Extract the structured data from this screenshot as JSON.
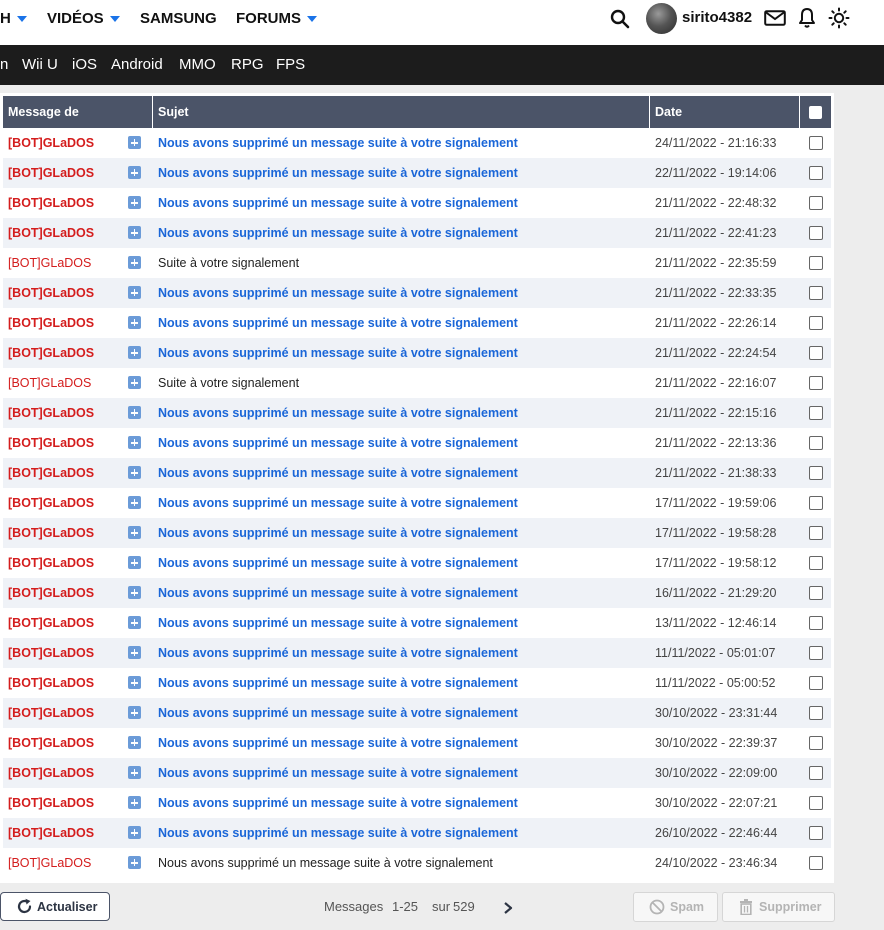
{
  "header": {
    "nav": [
      {
        "label": "H",
        "dropdown": true
      },
      {
        "label": "VIDÉOS",
        "dropdown": true
      },
      {
        "label": "SAMSUNG",
        "dropdown": false
      },
      {
        "label": "FORUMS",
        "dropdown": true
      }
    ],
    "user": {
      "name": "sirito4382"
    },
    "icons": [
      "search-icon",
      "avatar",
      "mail-icon",
      "bell-icon",
      "theme-sun-icon"
    ]
  },
  "categories": [
    "n",
    "Wii U",
    "iOS",
    "Android",
    "MMO",
    "RPG",
    "FPS"
  ],
  "table": {
    "columns": {
      "author": "Message de",
      "subject": "Sujet",
      "date": "Date"
    },
    "rows": [
      {
        "author": "[BOT]GLaDOS",
        "subject": "Nous avons supprimé un message suite à votre signalement",
        "date": "24/11/2022 - 21:16:33",
        "unread": true
      },
      {
        "author": "[BOT]GLaDOS",
        "subject": "Nous avons supprimé un message suite à votre signalement",
        "date": "22/11/2022 - 19:14:06",
        "unread": true
      },
      {
        "author": "[BOT]GLaDOS",
        "subject": "Nous avons supprimé un message suite à votre signalement",
        "date": "21/11/2022 - 22:48:32",
        "unread": true
      },
      {
        "author": "[BOT]GLaDOS",
        "subject": "Nous avons supprimé un message suite à votre signalement",
        "date": "21/11/2022 - 22:41:23",
        "unread": true
      },
      {
        "author": "[BOT]GLaDOS",
        "subject": "Suite à votre signalement",
        "date": "21/11/2022 - 22:35:59",
        "unread": false
      },
      {
        "author": "[BOT]GLaDOS",
        "subject": "Nous avons supprimé un message suite à votre signalement",
        "date": "21/11/2022 - 22:33:35",
        "unread": true
      },
      {
        "author": "[BOT]GLaDOS",
        "subject": "Nous avons supprimé un message suite à votre signalement",
        "date": "21/11/2022 - 22:26:14",
        "unread": true
      },
      {
        "author": "[BOT]GLaDOS",
        "subject": "Nous avons supprimé un message suite à votre signalement",
        "date": "21/11/2022 - 22:24:54",
        "unread": true
      },
      {
        "author": "[BOT]GLaDOS",
        "subject": "Suite à votre signalement",
        "date": "21/11/2022 - 22:16:07",
        "unread": false
      },
      {
        "author": "[BOT]GLaDOS",
        "subject": "Nous avons supprimé un message suite à votre signalement",
        "date": "21/11/2022 - 22:15:16",
        "unread": true
      },
      {
        "author": "[BOT]GLaDOS",
        "subject": "Nous avons supprimé un message suite à votre signalement",
        "date": "21/11/2022 - 22:13:36",
        "unread": true
      },
      {
        "author": "[BOT]GLaDOS",
        "subject": "Nous avons supprimé un message suite à votre signalement",
        "date": "21/11/2022 - 21:38:33",
        "unread": true
      },
      {
        "author": "[BOT]GLaDOS",
        "subject": "Nous avons supprimé un message suite à votre signalement",
        "date": "17/11/2022 - 19:59:06",
        "unread": true
      },
      {
        "author": "[BOT]GLaDOS",
        "subject": "Nous avons supprimé un message suite à votre signalement",
        "date": "17/11/2022 - 19:58:28",
        "unread": true
      },
      {
        "author": "[BOT]GLaDOS",
        "subject": "Nous avons supprimé un message suite à votre signalement",
        "date": "17/11/2022 - 19:58:12",
        "unread": true
      },
      {
        "author": "[BOT]GLaDOS",
        "subject": "Nous avons supprimé un message suite à votre signalement",
        "date": "16/11/2022 - 21:29:20",
        "unread": true
      },
      {
        "author": "[BOT]GLaDOS",
        "subject": "Nous avons supprimé un message suite à votre signalement",
        "date": "13/11/2022 - 12:46:14",
        "unread": true
      },
      {
        "author": "[BOT]GLaDOS",
        "subject": "Nous avons supprimé un message suite à votre signalement",
        "date": "11/11/2022 - 05:01:07",
        "unread": true
      },
      {
        "author": "[BOT]GLaDOS",
        "subject": "Nous avons supprimé un message suite à votre signalement",
        "date": "11/11/2022 - 05:00:52",
        "unread": true
      },
      {
        "author": "[BOT]GLaDOS",
        "subject": "Nous avons supprimé un message suite à votre signalement",
        "date": "30/10/2022 - 23:31:44",
        "unread": true
      },
      {
        "author": "[BOT]GLaDOS",
        "subject": "Nous avons supprimé un message suite à votre signalement",
        "date": "30/10/2022 - 22:39:37",
        "unread": true
      },
      {
        "author": "[BOT]GLaDOS",
        "subject": "Nous avons supprimé un message suite à votre signalement",
        "date": "30/10/2022 - 22:09:00",
        "unread": true
      },
      {
        "author": "[BOT]GLaDOS",
        "subject": "Nous avons supprimé un message suite à votre signalement",
        "date": "30/10/2022 - 22:07:21",
        "unread": true
      },
      {
        "author": "[BOT]GLaDOS",
        "subject": "Nous avons supprimé un message suite à votre signalement",
        "date": "26/10/2022 - 22:46:44",
        "unread": true
      },
      {
        "author": "[BOT]GLaDOS",
        "subject": "Nous avons supprimé un message suite à votre signalement",
        "date": "24/10/2022 - 23:46:34",
        "unread": false
      }
    ]
  },
  "footer": {
    "refresh_label": "Actualiser",
    "pagination": {
      "prefix": "Messages",
      "range": "1-25",
      "middle": "sur",
      "total": "529"
    },
    "spam_label": "Spam",
    "delete_label": "Supprimer"
  },
  "colors": {
    "header_bg": "#4b5468",
    "category_bar": "#1c1c1c",
    "unread_link": "#1a66d8",
    "author": "#d41d1d",
    "accent_orange": "#e8562a",
    "nav_caret": "#1a73e8"
  }
}
